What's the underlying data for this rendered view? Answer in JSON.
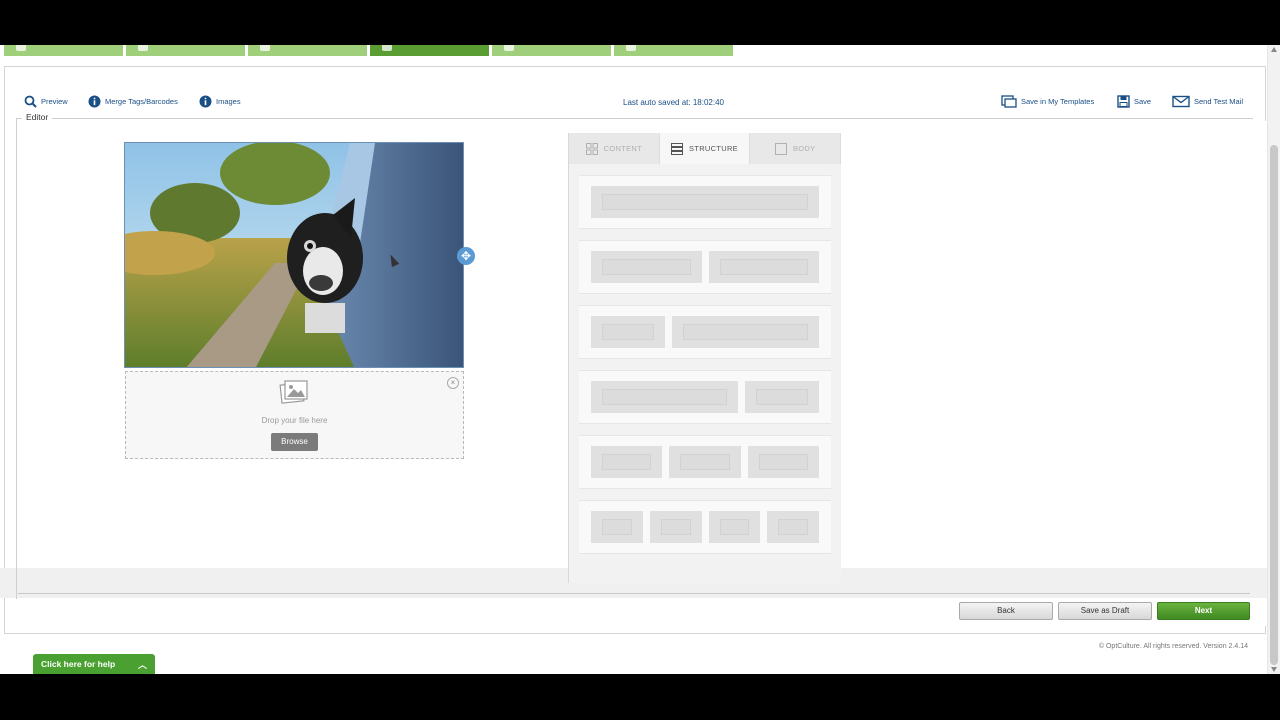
{
  "steps": [
    {
      "label": "",
      "active": false
    },
    {
      "label": "",
      "active": false
    },
    {
      "label": "",
      "active": false
    },
    {
      "label": "",
      "active": true
    },
    {
      "label": "",
      "active": false
    },
    {
      "label": "",
      "active": false
    }
  ],
  "toolbar": {
    "preview": "Preview",
    "merge_tags": "Merge Tags/Barcodes",
    "images": "Images",
    "autosave": "Last auto saved at: 18:02:40",
    "save_in_templates": "Save in My Templates",
    "save": "Save",
    "send_test": "Send Test Mail"
  },
  "editor": {
    "legend": "Editor",
    "dropzone_text": "Drop your file here",
    "browse_label": "Browse"
  },
  "side_panel": {
    "tabs": [
      {
        "label": "CONTENT",
        "icon": "grid-icon",
        "active": false
      },
      {
        "label": "STRUCTURE",
        "icon": "rows-icon",
        "active": true
      },
      {
        "label": "BODY",
        "icon": "square-icon",
        "active": false
      }
    ],
    "structures": [
      [
        1
      ],
      [
        1,
        1
      ],
      [
        1,
        2
      ],
      [
        2,
        1
      ],
      [
        1,
        1,
        1
      ],
      [
        1,
        1,
        1,
        1
      ]
    ]
  },
  "footer": {
    "back_label": "Back",
    "draft_label": "Save as Draft",
    "next_label": "Next",
    "copyright": "© OptCulture. All rights reserved. Version 2.4.14",
    "help_label": "Click here for help"
  },
  "colors": {
    "accent_green": "#4aa131",
    "link_blue": "#1a4f86"
  }
}
